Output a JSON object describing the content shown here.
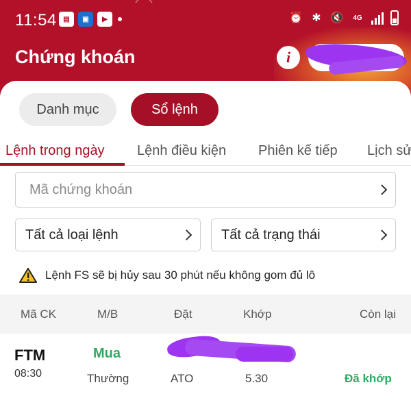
{
  "status_bar": {
    "time": "11:54",
    "network": "4G",
    "app_icons": [
      "notes-app-icon",
      "store-app-icon",
      "video-app-icon"
    ]
  },
  "header": {
    "title": "Chứng khoán",
    "info_symbol": "i"
  },
  "segments": [
    {
      "label": "Danh mục",
      "active": false
    },
    {
      "label": "Sổ lệnh",
      "active": true
    }
  ],
  "tabs": [
    {
      "label": "Lệnh trong ngày",
      "active": true
    },
    {
      "label": "Lệnh điều kiện",
      "active": false
    },
    {
      "label": "Phiên kế tiếp",
      "active": false
    },
    {
      "label": "Lịch sử",
      "active": false
    }
  ],
  "filters": {
    "search_placeholder": "Mã chứng khoán",
    "order_type": "Tất cả loại lệnh",
    "order_status": "Tất cả trạng thái"
  },
  "notice": "Lệnh FS sẽ bị hủy sau 30 phút nếu không gom đủ lô",
  "table": {
    "columns": [
      "Mã CK",
      "M/B",
      "Đặt",
      "Khớp",
      "Còn lại"
    ],
    "rows": [
      {
        "symbol": "FTM",
        "time": "08:30",
        "side": "Mua",
        "order_type": "Thường",
        "order_price": "ATO",
        "matched_price": "5.30",
        "status": "Đã khớp"
      }
    ]
  },
  "colors": {
    "brand_red": "#b3102a",
    "active_red": "#a51026",
    "buy_green": "#2eaa62",
    "redaction_purple": "#9c34f0"
  }
}
